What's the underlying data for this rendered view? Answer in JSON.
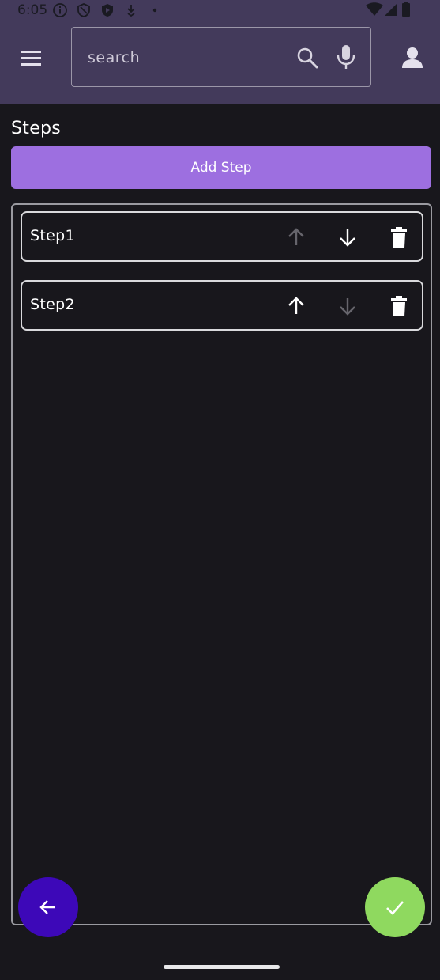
{
  "status_bar": {
    "time": "6:05",
    "icons": [
      "info-icon",
      "shield-icon",
      "play-protect-icon",
      "download-icon",
      "dot-icon"
    ],
    "right_icons": [
      "wifi-icon",
      "signal-icon",
      "battery-icon"
    ]
  },
  "app_bar": {
    "menu_icon": "menu-icon",
    "search": {
      "placeholder": "search",
      "value": ""
    },
    "search_icon": "search-icon",
    "mic_icon": "mic-icon",
    "account_icon": "account-icon",
    "background_color": "#433a5b"
  },
  "page": {
    "title": "Steps",
    "add_button_label": "Add Step",
    "add_button_color": "#9d6fe0"
  },
  "steps": [
    {
      "label": "Step1",
      "can_move_up": false,
      "can_move_down": true
    },
    {
      "label": "Step2",
      "can_move_up": true,
      "can_move_down": false
    }
  ],
  "fabs": {
    "back": {
      "icon": "arrow-left-icon",
      "color": "#3d08b8"
    },
    "confirm": {
      "icon": "check-icon",
      "color": "#8fd95f"
    }
  }
}
